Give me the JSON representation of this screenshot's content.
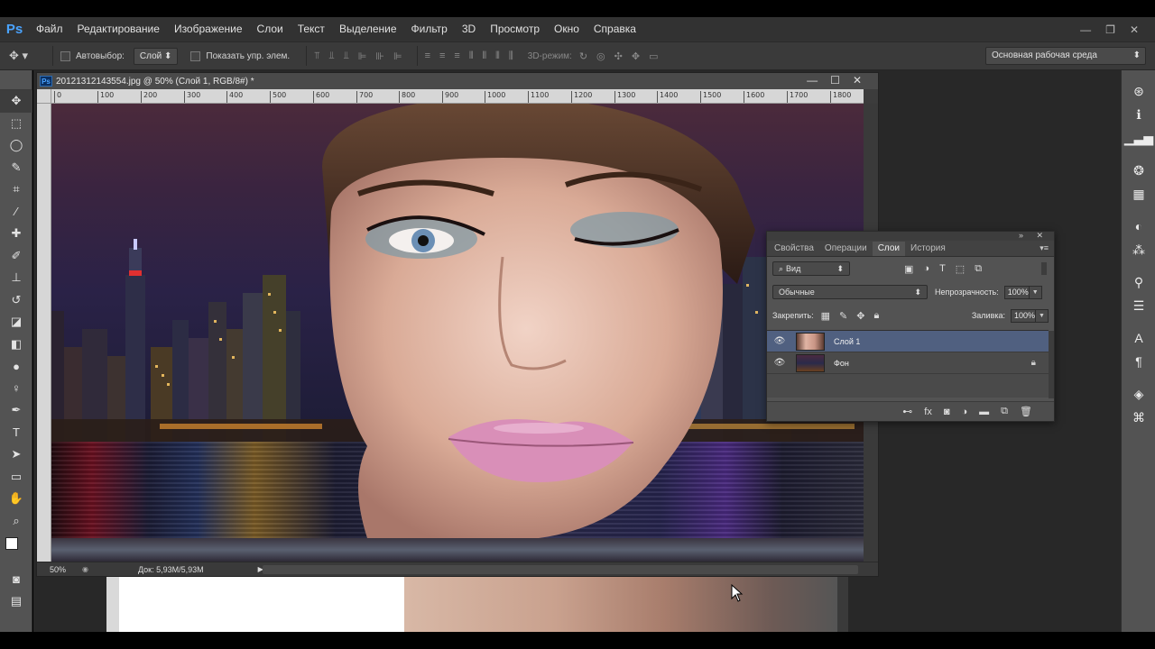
{
  "app": {
    "logo": "Ps",
    "menu": [
      "Файл",
      "Редактирование",
      "Изображение",
      "Слои",
      "Текст",
      "Выделение",
      "Фильтр",
      "3D",
      "Просмотр",
      "Окно",
      "Справка"
    ],
    "window_controls": [
      "—",
      "❐",
      "✕"
    ]
  },
  "options": {
    "autoselect_label": "Автовыбор:",
    "autoselect_value": "Слой",
    "show_transform_label": "Показать упр. элем.",
    "mode3d_label": "3D-режим:",
    "workspace": "Основная рабочая среда"
  },
  "document": {
    "title": "20121312143554.jpg @ 50% (Слой 1, RGB/8#) *",
    "ruler_ticks": [
      "0",
      "100",
      "200",
      "300",
      "400",
      "500",
      "600",
      "700",
      "800",
      "900",
      "1000",
      "1100",
      "1200",
      "1300",
      "1400",
      "1500",
      "1600",
      "1700",
      "1800"
    ],
    "zoom": "50%",
    "doc_info": "Док: 5,93M/5,93M"
  },
  "layers_panel": {
    "tabs": [
      "Свойства",
      "Операции",
      "Слои",
      "История"
    ],
    "active_tab": "Слои",
    "filter_kind": "Вид",
    "blend_mode": "Обычные",
    "opacity_label": "Непрозрачность:",
    "opacity_value": "100%",
    "lock_label": "Закрепить:",
    "fill_label": "Заливка:",
    "fill_value": "100%",
    "layers": [
      {
        "name": "Слой 1",
        "selected": true,
        "visible": true,
        "locked": false
      },
      {
        "name": "Фон",
        "selected": false,
        "visible": true,
        "locked": true
      }
    ]
  },
  "colors": {
    "foreground": "#ffffff",
    "background": "#1f4fbf",
    "selection": "#506080",
    "ps_blue": "#4aa3ff"
  },
  "icons": {
    "tools": [
      "move-icon",
      "marquee-icon",
      "lasso-icon",
      "quick-select-icon",
      "crop-icon",
      "eyedropper-icon",
      "healing-brush-icon",
      "brush-icon",
      "clone-stamp-icon",
      "history-brush-icon",
      "eraser-icon",
      "gradient-icon",
      "blur-icon",
      "dodge-icon",
      "pen-icon",
      "type-icon",
      "path-select-icon",
      "rectangle-icon",
      "hand-icon",
      "zoom-icon"
    ],
    "panel_strip": [
      "history-icon",
      "info-icon",
      "histogram-icon",
      "color-icon",
      "swatches-icon",
      "adjustments-icon",
      "styles-icon",
      "brush-presets-icon",
      "clone-source-icon",
      "character-icon",
      "paragraph-icon",
      "3d-icon",
      "paths-icon"
    ]
  }
}
